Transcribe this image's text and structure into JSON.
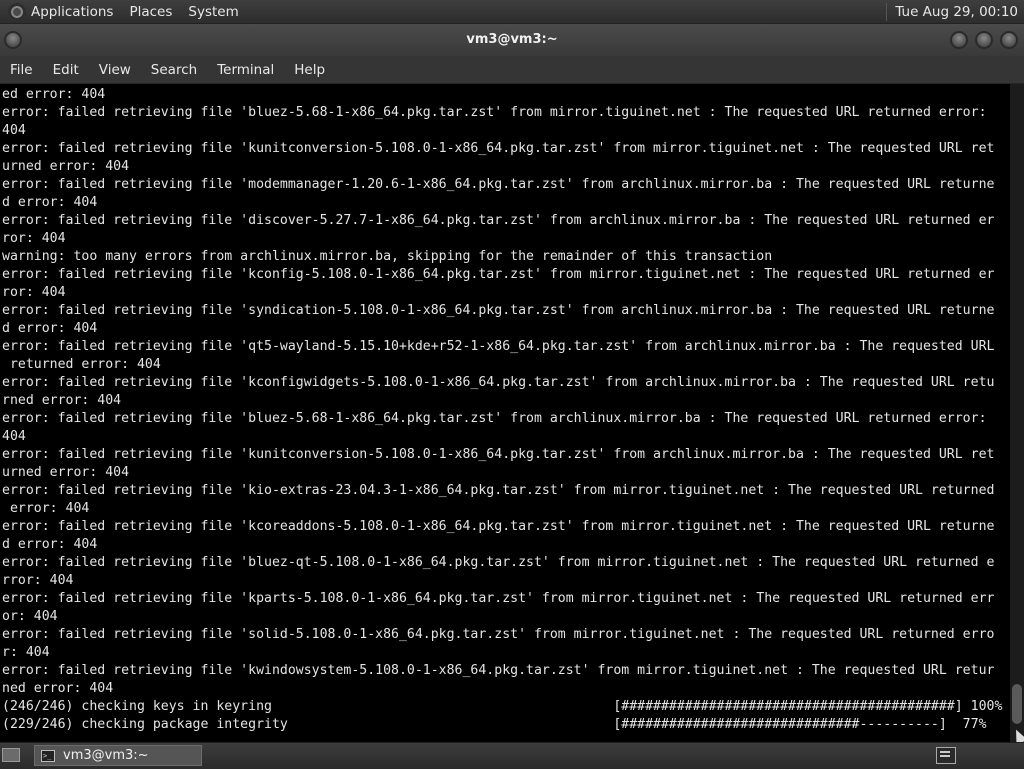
{
  "top_panel": {
    "menus": [
      "Applications",
      "Places",
      "System"
    ],
    "clock": "Tue Aug 29, 00:10"
  },
  "window": {
    "title": "vm3@vm3:~"
  },
  "menu_bar": [
    "File",
    "Edit",
    "View",
    "Search",
    "Terminal",
    "Help"
  ],
  "terminal": {
    "lines": [
      "ed error: 404",
      "error: failed retrieving file 'bluez-5.68-1-x86_64.pkg.tar.zst' from mirror.tiguinet.net : The requested URL returned error:",
      "404",
      "error: failed retrieving file 'kunitconversion-5.108.0-1-x86_64.pkg.tar.zst' from mirror.tiguinet.net : The requested URL ret",
      "urned error: 404",
      "error: failed retrieving file 'modemmanager-1.20.6-1-x86_64.pkg.tar.zst' from archlinux.mirror.ba : The requested URL returne",
      "d error: 404",
      "error: failed retrieving file 'discover-5.27.7-1-x86_64.pkg.tar.zst' from archlinux.mirror.ba : The requested URL returned er",
      "ror: 404",
      "warning: too many errors from archlinux.mirror.ba, skipping for the remainder of this transaction",
      "error: failed retrieving file 'kconfig-5.108.0-1-x86_64.pkg.tar.zst' from mirror.tiguinet.net : The requested URL returned er",
      "ror: 404",
      "error: failed retrieving file 'syndication-5.108.0-1-x86_64.pkg.tar.zst' from archlinux.mirror.ba : The requested URL returne",
      "d error: 404",
      "error: failed retrieving file 'qt5-wayland-5.15.10+kde+r52-1-x86_64.pkg.tar.zst' from archlinux.mirror.ba : The requested URL",
      " returned error: 404",
      "error: failed retrieving file 'kconfigwidgets-5.108.0-1-x86_64.pkg.tar.zst' from archlinux.mirror.ba : The requested URL retu",
      "rned error: 404",
      "error: failed retrieving file 'bluez-5.68-1-x86_64.pkg.tar.zst' from archlinux.mirror.ba : The requested URL returned error:",
      "404",
      "error: failed retrieving file 'kunitconversion-5.108.0-1-x86_64.pkg.tar.zst' from archlinux.mirror.ba : The requested URL ret",
      "urned error: 404",
      "error: failed retrieving file 'kio-extras-23.04.3-1-x86_64.pkg.tar.zst' from mirror.tiguinet.net : The requested URL returned",
      " error: 404",
      "error: failed retrieving file 'kcoreaddons-5.108.0-1-x86_64.pkg.tar.zst' from mirror.tiguinet.net : The requested URL returne",
      "d error: 404",
      "error: failed retrieving file 'bluez-qt-5.108.0-1-x86_64.pkg.tar.zst' from mirror.tiguinet.net : The requested URL returned e",
      "rror: 404",
      "error: failed retrieving file 'kparts-5.108.0-1-x86_64.pkg.tar.zst' from mirror.tiguinet.net : The requested URL returned err",
      "or: 404",
      "error: failed retrieving file 'solid-5.108.0-1-x86_64.pkg.tar.zst' from mirror.tiguinet.net : The requested URL returned erro",
      "r: 404",
      "error: failed retrieving file 'kwindowsystem-5.108.0-1-x86_64.pkg.tar.zst' from mirror.tiguinet.net : The requested URL retur",
      "ned error: 404",
      "(246/246) checking keys in keyring                                           [##########################################] 100%",
      "(229/246) checking package integrity                                         [##############################----------]  77%"
    ]
  },
  "taskbar": {
    "task_label": "vm3@vm3:~"
  }
}
